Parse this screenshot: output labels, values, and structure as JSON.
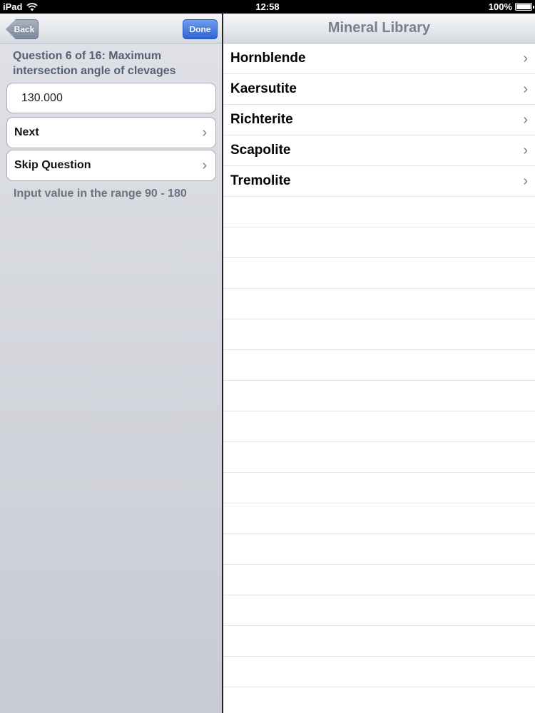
{
  "status_bar": {
    "device": "iPad",
    "time": "12:58",
    "battery": "100%"
  },
  "left": {
    "back_label": "Back",
    "done_label": "Done",
    "question": "Question 6 of 16: Maximum intersection angle of clevages",
    "input_value": "130.000",
    "next_label": "Next",
    "skip_label": "Skip Question",
    "hint": "Input value in the range 90 - 180"
  },
  "right": {
    "title": "Mineral Library",
    "items": [
      {
        "label": "Hornblende"
      },
      {
        "label": "Kaersutite"
      },
      {
        "label": "Richterite"
      },
      {
        "label": "Scapolite"
      },
      {
        "label": "Tremolite"
      }
    ]
  },
  "icons": {
    "chevron": "chevron-right-icon",
    "wifi": "wifi-icon",
    "battery": "battery-icon"
  }
}
